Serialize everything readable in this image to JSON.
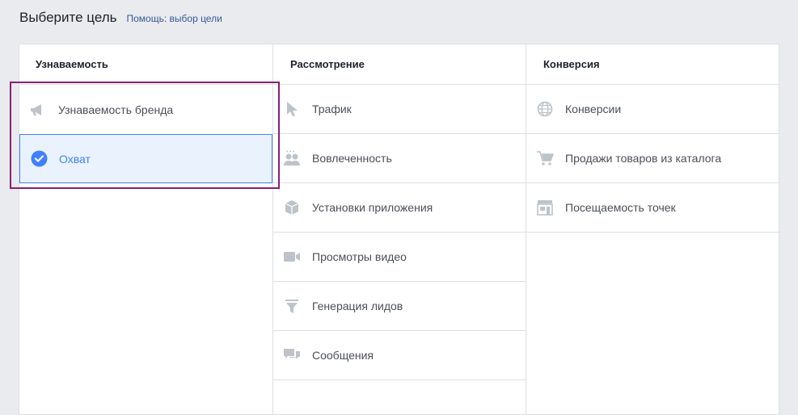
{
  "header": {
    "title": "Выберите цель",
    "help": "Помощь: выбор цели"
  },
  "columns": [
    {
      "title": "Узнаваемость",
      "items": [
        {
          "label": "Узнаваемость бренда",
          "icon": "megaphone-icon"
        },
        {
          "label": "Охват",
          "icon": "check-circle-icon",
          "selected": true
        }
      ]
    },
    {
      "title": "Рассмотрение",
      "items": [
        {
          "label": "Трафик",
          "icon": "cursor-icon"
        },
        {
          "label": "Вовлеченность",
          "icon": "people-icon"
        },
        {
          "label": "Установки приложения",
          "icon": "box-icon"
        },
        {
          "label": "Просмотры видео",
          "icon": "video-camera-icon"
        },
        {
          "label": "Генерация лидов",
          "icon": "funnel-icon"
        },
        {
          "label": "Сообщения",
          "icon": "chat-bubbles-icon"
        }
      ]
    },
    {
      "title": "Конверсия",
      "items": [
        {
          "label": "Конверсии",
          "icon": "globe-icon"
        },
        {
          "label": "Продажи товаров из каталога",
          "icon": "cart-icon"
        },
        {
          "label": "Посещаемость точек",
          "icon": "store-icon"
        }
      ]
    }
  ],
  "colors": {
    "accent": "#4080ff",
    "selected_bg": "#eaf3fd",
    "highlight": "#8a2073",
    "icon": "#bec3c9"
  }
}
